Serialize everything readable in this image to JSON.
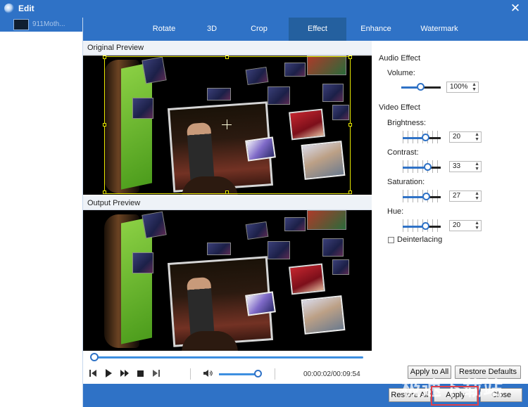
{
  "window": {
    "title": "Edit",
    "close_glyph": "✕"
  },
  "file_list": {
    "items": [
      {
        "name": "911Moth..."
      }
    ]
  },
  "tabs": [
    "Rotate",
    "3D",
    "Crop",
    "Effect",
    "Enhance",
    "Watermark"
  ],
  "active_tab": "Effect",
  "preview": {
    "original_label": "Original Preview",
    "output_label": "Output Preview"
  },
  "playback": {
    "timecode": "00:00:02/00:09:54",
    "progress": 0.01,
    "volume": 0.9
  },
  "audio_effect": {
    "title": "Audio Effect",
    "volume_label": "Volume:",
    "volume_value": "100%",
    "volume_level": 0.5
  },
  "video_effect": {
    "title": "Video Effect",
    "brightness": {
      "label": "Brightness:",
      "value": "20",
      "level": 0.6
    },
    "contrast": {
      "label": "Contrast:",
      "value": "33",
      "level": 0.66
    },
    "saturation": {
      "label": "Saturation:",
      "value": "27",
      "level": 0.63
    },
    "hue": {
      "label": "Hue:",
      "value": "20",
      "level": 0.6
    }
  },
  "deinterlacing": {
    "label": "Deinterlacing",
    "checked": false
  },
  "buttons": {
    "apply_to_all": "Apply to All",
    "restore_defaults": "Restore Defaults",
    "restore_all": "Restore All",
    "apply": "Apply",
    "close": "Close"
  },
  "watermark_text": "极速下载站",
  "colors": {
    "accent": "#2f72c6",
    "active_tab": "#24609f"
  },
  "icons": [
    "app-logo-icon",
    "close-icon",
    "skip-back-icon",
    "play-icon",
    "fast-forward-icon",
    "stop-icon",
    "skip-end-icon",
    "speaker-icon"
  ]
}
